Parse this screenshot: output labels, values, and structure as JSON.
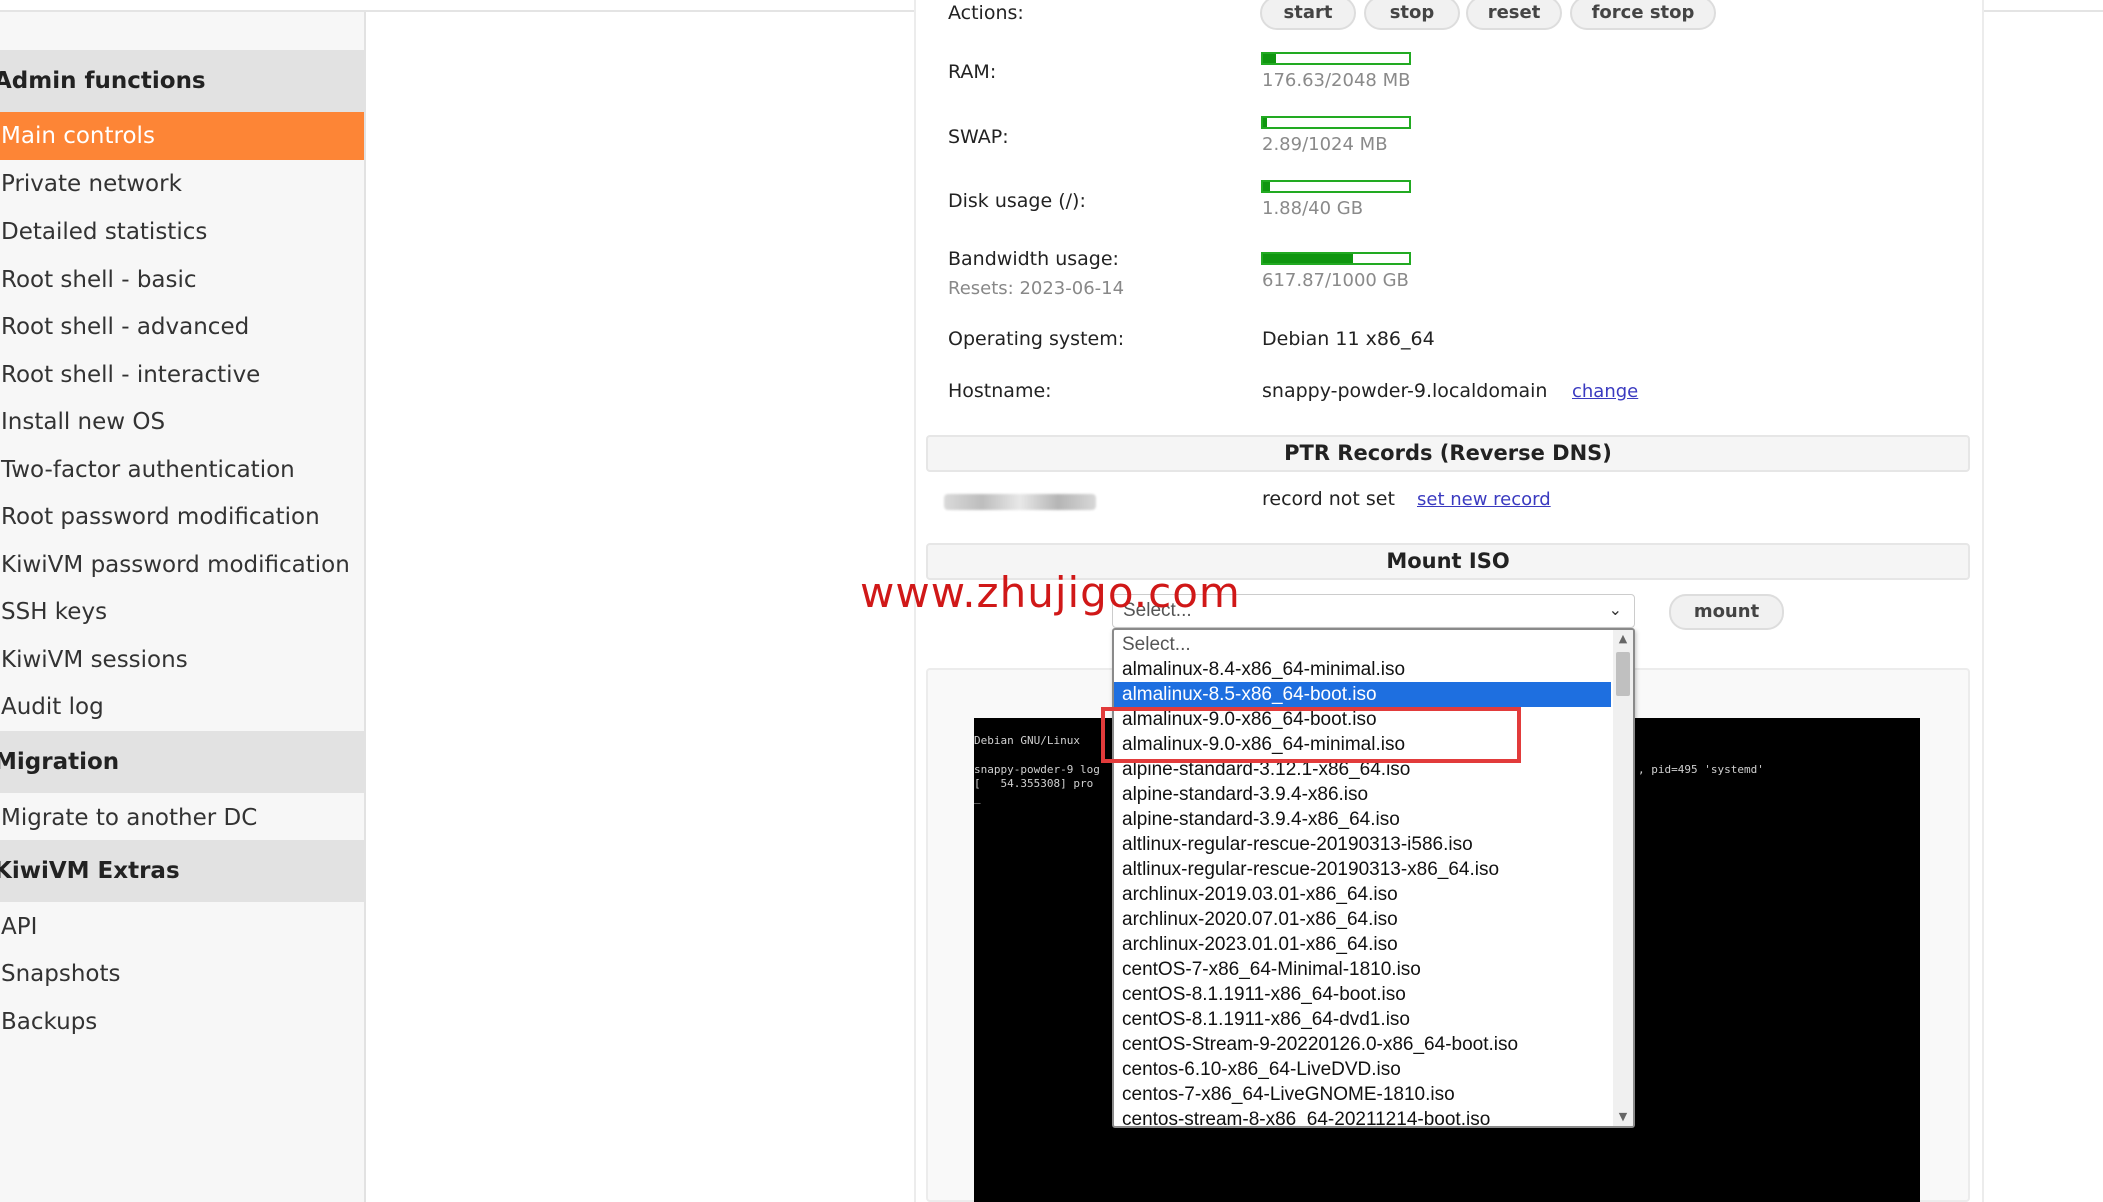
{
  "sidebar": {
    "sections": [
      {
        "title": "Admin functions",
        "items": [
          "Main controls",
          "Private network",
          "Detailed statistics",
          "Root shell - basic",
          "Root shell - advanced",
          "Root shell - interactive",
          "Install new OS",
          "Two-factor authentication",
          "Root password modification",
          "KiwiVM password modification",
          "SSH keys",
          "KiwiVM sessions",
          "Audit log"
        ]
      },
      {
        "title": "Migration",
        "items": [
          "Migrate to another DC"
        ]
      },
      {
        "title": "KiwiVM Extras",
        "items": [
          "API",
          "Snapshots",
          "Backups"
        ]
      }
    ],
    "active_item": "Main controls"
  },
  "server": {
    "actions_label": "Actions:",
    "actions": [
      "start",
      "stop",
      "reset",
      "force stop"
    ],
    "ram": {
      "label": "RAM:",
      "value": "176.63/2048 MB",
      "usage_fraction": 0.086
    },
    "swap": {
      "label": "SWAP:",
      "value": "2.89/1024 MB",
      "usage_fraction": 0.003
    },
    "disk": {
      "label": "Disk usage (/):",
      "value": "1.88/40 GB",
      "usage_fraction": 0.047
    },
    "bandwidth": {
      "label": "Bandwidth usage:",
      "resets": "Resets: 2023-06-14",
      "value": "617.87/1000 GB",
      "usage_fraction": 0.618
    },
    "os": {
      "label": "Operating system:",
      "value": "Debian 11 x86_64"
    },
    "hostname": {
      "label": "Hostname:",
      "value": "snappy-powder-9.localdomain",
      "change_link": "change"
    }
  },
  "ptr": {
    "title": "PTR Records (Reverse DNS)",
    "status": "record not set",
    "set_link": "set new record"
  },
  "mount_iso": {
    "title": "Mount ISO",
    "select_value": "Select...",
    "mount_button": "mount",
    "options": [
      "Select...",
      "almalinux-8.4-x86_64-minimal.iso",
      "almalinux-8.5-x86_64-boot.iso",
      "almalinux-9.0-x86_64-boot.iso",
      "almalinux-9.0-x86_64-minimal.iso",
      "alpine-standard-3.12.1-x86_64.iso",
      "alpine-standard-3.9.4-x86.iso",
      "alpine-standard-3.9.4-x86_64.iso",
      "altlinux-regular-rescue-20190313-i586.iso",
      "altlinux-regular-rescue-20190313-x86_64.iso",
      "archlinux-2019.03.01-x86_64.iso",
      "archlinux-2020.07.01-x86_64.iso",
      "archlinux-2023.01.01-x86_64.iso",
      "centOS-7-x86_64-Minimal-1810.iso",
      "centOS-8.1.1911-x86_64-boot.iso",
      "centOS-8.1.1911-x86_64-dvd1.iso",
      "centOS-Stream-9-20220126.0-x86_64-boot.iso",
      "centos-6.10-x86_64-LiveDVD.iso",
      "centos-7-x86_64-LiveGNOME-1810.iso",
      "centos-stream-8-x86_64-20211214-boot.iso"
    ],
    "highlighted_option": "almalinux-8.5-x86_64-boot.iso"
  },
  "console": {
    "lines": [
      "Debian GNU/Linux",
      "snappy-powder-9 log",
      "[   54.355308] pro",
      "_",
      ", pid=495 'systemd'"
    ]
  },
  "watermark": "www.zhujigo.com",
  "colors": {
    "active_item_bg": "#fd8536",
    "bar_fill": "#109610",
    "bar_border": "#22aa22",
    "option_highlight": "#1e6fe0",
    "annotation_red": "#e23b3b",
    "watermark_red": "#d01818"
  },
  "icons": {
    "select_chevron": "chevron-down-icon",
    "scroll_up": "scroll-up-arrow-icon",
    "scroll_down": "scroll-down-arrow-icon"
  }
}
